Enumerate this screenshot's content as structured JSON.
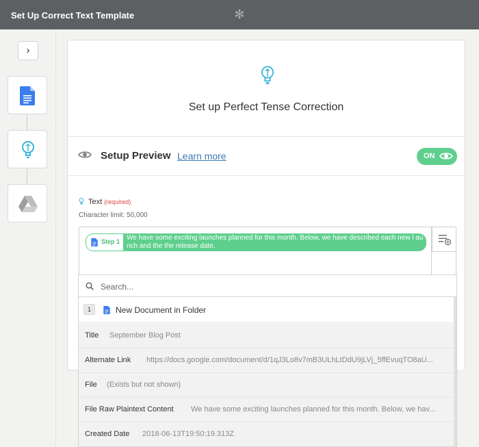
{
  "window": {
    "title": "Set Up Correct Text Template",
    "loading_icon": "spinner-icon"
  },
  "sidebar": {
    "toggle_icon": "chevron-right-icon",
    "toggle_glyph": "›",
    "steps": [
      {
        "icon": "google-docs-icon",
        "app": "Google Docs"
      },
      {
        "icon": "lightbulb-icon",
        "app": "Perfect Tense"
      },
      {
        "icon": "google-drive-icon",
        "app": "Google Drive"
      }
    ]
  },
  "panel": {
    "title": "Set up Perfect Tense Correction",
    "setup_preview": {
      "label": "Setup Preview",
      "link": "Learn more",
      "toggle": "ON"
    },
    "field": {
      "label": "Text",
      "required": "(required)",
      "char_limit": "Character limit: 50,000",
      "token": {
        "step_label": "Step 1",
        "text": "We have some exciting launches planned for this month. Below, we have described each new l aunch and the the release date."
      }
    }
  },
  "dropdown": {
    "search_placeholder": "Search...",
    "group": {
      "number": "1",
      "name": "New Document in Folder"
    },
    "rows": [
      {
        "key": "Title",
        "value": "September Blog Post"
      },
      {
        "key": "Alternate Link",
        "value": "https://docs.google.com/document/d/1qJ3Lo8v7mB3ULhLtDdU9jLVj_5ffEvuqTO8aU..."
      },
      {
        "key": "File",
        "value": "(Exists but not shown)"
      },
      {
        "key": "File Raw Plaintext Content",
        "value": "We have some exciting launches planned for this month. Below, we hav..."
      },
      {
        "key": "Created Date",
        "value": "2018-06-13T19:50:19.313Z"
      }
    ]
  },
  "colors": {
    "accent_green": "#5fcf8d",
    "topbar": "#5c6063",
    "link": "#3c78b4",
    "required": "#e0443a"
  }
}
